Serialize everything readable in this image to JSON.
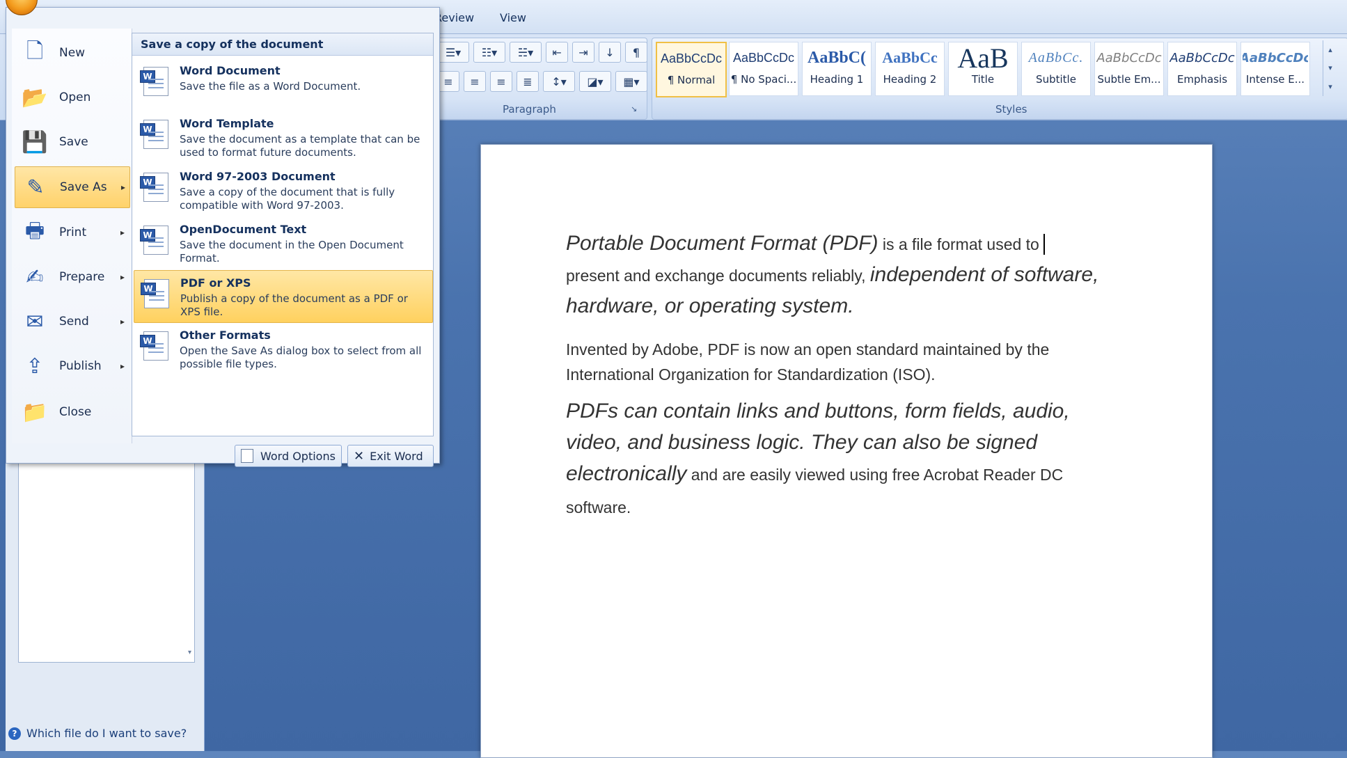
{
  "ribbon": {
    "tabs": [
      {
        "label": "Review"
      },
      {
        "label": "View"
      }
    ],
    "group_paragraph_label": "Paragraph",
    "group_styles_label": "Styles",
    "styles": [
      {
        "sample": "AaBbCcDc",
        "name": "¶ Normal",
        "selected": true
      },
      {
        "sample": "AaBbCcDc",
        "name": "¶ No Spaci..."
      },
      {
        "sample": "AaBbC(",
        "name": "Heading 1"
      },
      {
        "sample": "AaBbCc",
        "name": "Heading 2"
      },
      {
        "sample": "AaB",
        "name": "Title"
      },
      {
        "sample": "AaBbCc.",
        "name": "Subtitle"
      },
      {
        "sample": "AaBbCcDc",
        "name": "Subtle Em..."
      },
      {
        "sample": "AaBbCcDc",
        "name": "Emphasis"
      },
      {
        "sample": "AaBbCcDc",
        "name": "Intense E..."
      }
    ]
  },
  "office_menu": {
    "items": [
      {
        "label": "New",
        "icon": "new-document-icon"
      },
      {
        "label": "Open",
        "icon": "folder-open-icon"
      },
      {
        "label": "Save",
        "icon": "save-disk-icon"
      },
      {
        "label": "Save As",
        "icon": "save-as-icon",
        "submenu": true,
        "active": true
      },
      {
        "label": "Print",
        "icon": "printer-icon",
        "submenu": true
      },
      {
        "label": "Prepare",
        "icon": "prepare-icon",
        "submenu": true
      },
      {
        "label": "Send",
        "icon": "send-icon",
        "submenu": true
      },
      {
        "label": "Publish",
        "icon": "publish-icon",
        "submenu": true
      },
      {
        "label": "Close",
        "icon": "close-folder-icon"
      }
    ],
    "submenu": {
      "header": "Save a copy of the document",
      "items": [
        {
          "title": "Word Document",
          "desc": "Save the file as a Word Document."
        },
        {
          "title": "Word Template",
          "desc": "Save the document as a template that can be used to format future documents."
        },
        {
          "title": "Word 97-2003 Document",
          "desc": "Save a copy of the document that is fully compatible with Word 97-2003."
        },
        {
          "title": "OpenDocument Text",
          "desc": "Save the document in the Open Document Format."
        },
        {
          "title": "PDF or XPS",
          "desc": "Publish a copy of the document as a PDF or XPS file.",
          "highlighted": true
        },
        {
          "title": "Other Formats",
          "desc": "Open the Save As dialog box to select from all possible file types."
        }
      ]
    },
    "word_options_label": "Word Options",
    "exit_word_label": "Exit Word"
  },
  "left_pane": {
    "help_link": "Which file do I want to save?"
  },
  "document": {
    "p1_italic_a": "Portable Document Format (PDF)",
    "p1_normal_a": " is a file format used to ",
    "p1_normal_b": "present and exchange documents reliably, ",
    "p1_italic_b": "independent of software, hardware, or operating system.",
    "p2": "Invented by Adobe, PDF is now an open standard maintained by the International Organization for Standardization (ISO).",
    "p3_italic": "PDFs can contain links and buttons, form fields, audio, video, and business logic. They can also be signed electronically",
    "p3_normal": " and are easily viewed using free Acrobat Reader DC software."
  }
}
